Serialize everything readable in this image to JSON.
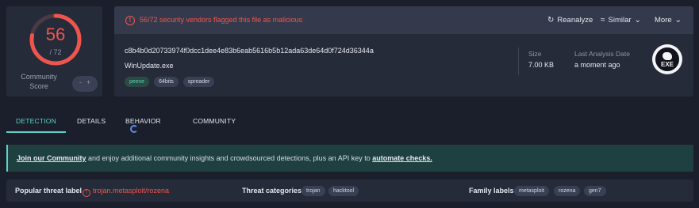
{
  "score": {
    "malicious": "56",
    "total": "/ 72",
    "community_label": "Community Score",
    "toggle_left": "-",
    "toggle_right": "+"
  },
  "alert": {
    "icon": "alert-circle-icon",
    "text": "56/72 security vendors flagged this file as malicious",
    "color": "#f0554c"
  },
  "actions": {
    "reanalyze": "Reanalyze",
    "similar": "Similar",
    "more": "More"
  },
  "file": {
    "hash": "c8b4b0d20733974f0dcc1dee4e83b6eab5616b5b12ada63de64d0f724d36344a",
    "name": "WinUpdate.exe",
    "tags": [
      "peexe",
      "64bits",
      "spreader"
    ]
  },
  "meta": {
    "size_label": "Size",
    "size_value": "7.00 KB",
    "date_label": "Last Analysis Date",
    "date_value": "a moment ago"
  },
  "file_type_badge": "EXE",
  "tabs": [
    "DETECTION",
    "DETAILS",
    "BEHAVIOR",
    "COMMUNITY"
  ],
  "banner": {
    "link1": "Join our Community",
    "middle": " and enjoy additional community insights and crowdsourced detections, plus an API key to ",
    "link2": "automate checks."
  },
  "threat": {
    "popular_label": "Popular threat label",
    "popular_value": "trojan.metasploit/rozena",
    "categories_label": "Threat categories",
    "categories": [
      "trojan",
      "hacktool"
    ],
    "family_label": "Family labels",
    "families": [
      "metasploit",
      "rozena",
      "gen7"
    ]
  },
  "colors": {
    "accent": "#5ad3c9",
    "danger": "#f0554c",
    "background": "#1b1f2b",
    "card": "#262b3a"
  }
}
